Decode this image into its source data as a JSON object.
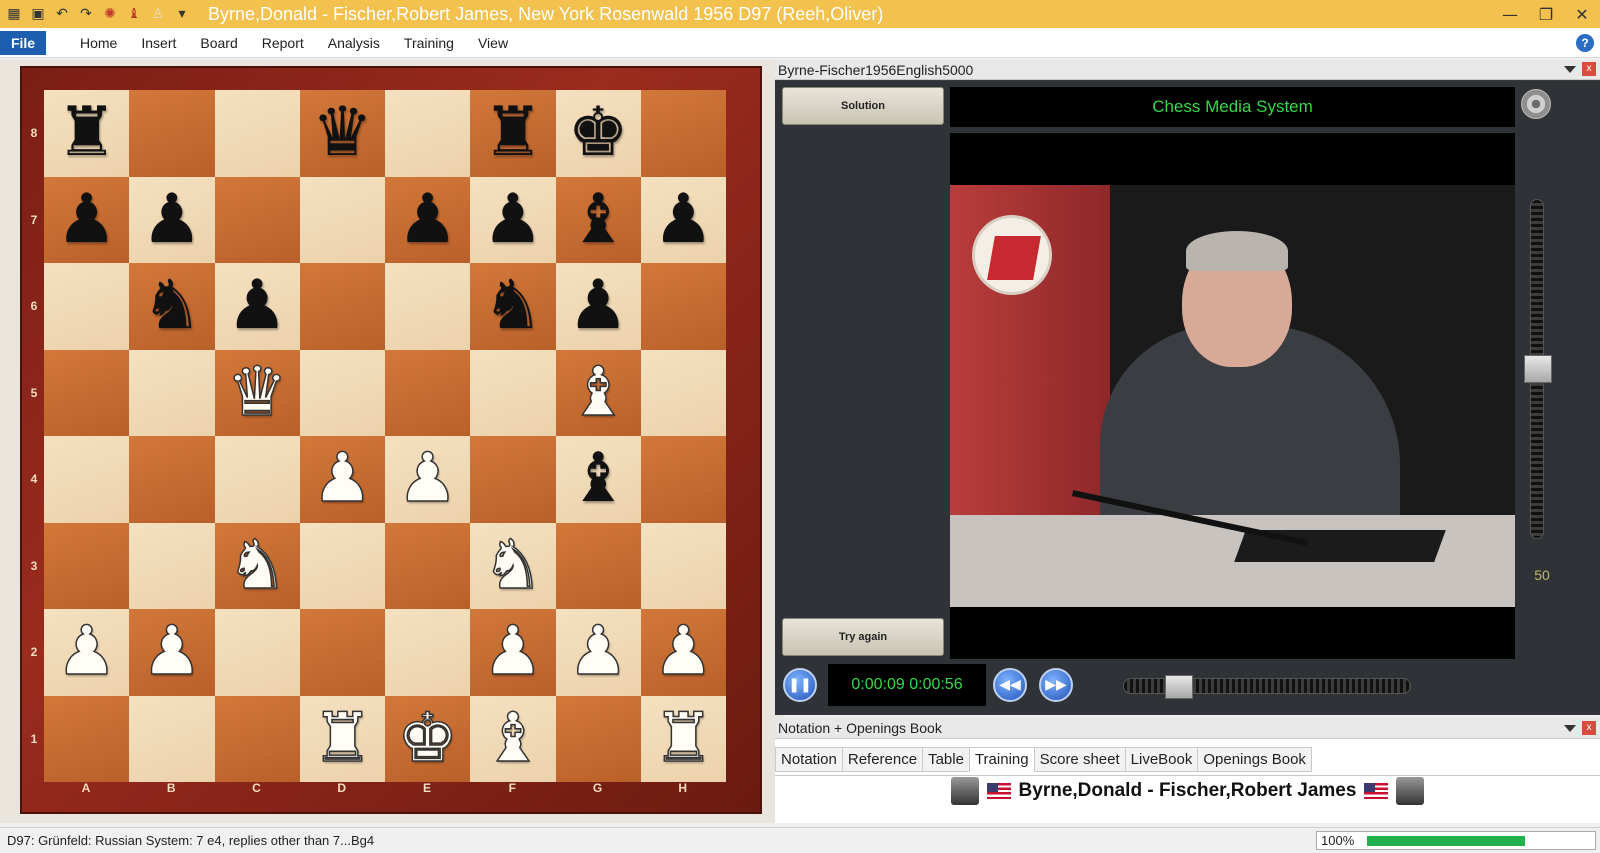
{
  "window": {
    "title": "Byrne,Donald - Fischer,Robert James, New York Rosenwald 1956  D97  (Reeh,Oliver)",
    "controls": [
      "minimize-icon",
      "restore-icon",
      "close-icon"
    ]
  },
  "quick_access": [
    "chessbase-logo-icon",
    "save-icon",
    "undo-icon",
    "redo-icon",
    "engine-icon",
    "piece-icon",
    "pawn-icon",
    "dropdown-icon"
  ],
  "menu": {
    "file": "File",
    "items": [
      "Home",
      "Insert",
      "Board",
      "Report",
      "Analysis",
      "Training",
      "View"
    ],
    "help": "?"
  },
  "board": {
    "ranks": [
      "8",
      "7",
      "6",
      "5",
      "4",
      "3",
      "2",
      "1"
    ],
    "files": [
      "A",
      "B",
      "C",
      "D",
      "E",
      "F",
      "G",
      "H"
    ],
    "position": [
      [
        "r",
        "",
        "",
        "q",
        "",
        "r",
        "k",
        ""
      ],
      [
        "p",
        "p",
        "",
        "",
        "p",
        "p",
        "b",
        "p"
      ],
      [
        "",
        "n",
        "p",
        "",
        "",
        "n",
        "p",
        ""
      ],
      [
        "",
        "",
        "Q",
        "",
        "",
        "",
        "B",
        ""
      ],
      [
        "",
        "",
        "",
        "P",
        "P",
        "",
        "b",
        ""
      ],
      [
        "",
        "",
        "N",
        "",
        "",
        "N",
        "",
        ""
      ],
      [
        "P",
        "P",
        "",
        "",
        "",
        "P",
        "P",
        "P"
      ],
      [
        "",
        "",
        "",
        "R",
        "K",
        "B",
        "",
        "R"
      ]
    ]
  },
  "media": {
    "panel_title": "Byrne-Fischer1956English5000",
    "solution_label": "Solution",
    "try_again_label": "Try again",
    "banner": "Chess Media System",
    "timecode": "0:00:09 0:00:56",
    "playback_progress": 0.16,
    "volume": "50",
    "volume_level": 0.5
  },
  "notation": {
    "panel_title": "Notation + Openings Book",
    "tabs": [
      "Notation",
      "Reference",
      "Table",
      "Training",
      "Score sheet",
      "LiveBook",
      "Openings Book"
    ],
    "active_tab": "Training",
    "players": "Byrne,Donald - Fischer,Robert James"
  },
  "status": {
    "text": "D97: Grünfeld: Russian System: 7 e4, replies other than 7...Bg4",
    "zoom": "100%",
    "zoom_fraction": 0.72
  },
  "colors": {
    "titlebar": "#f2c14e",
    "file_button": "#1d5fae",
    "accent_green": "#34d84c",
    "zoom_bar": "#22b04c"
  }
}
